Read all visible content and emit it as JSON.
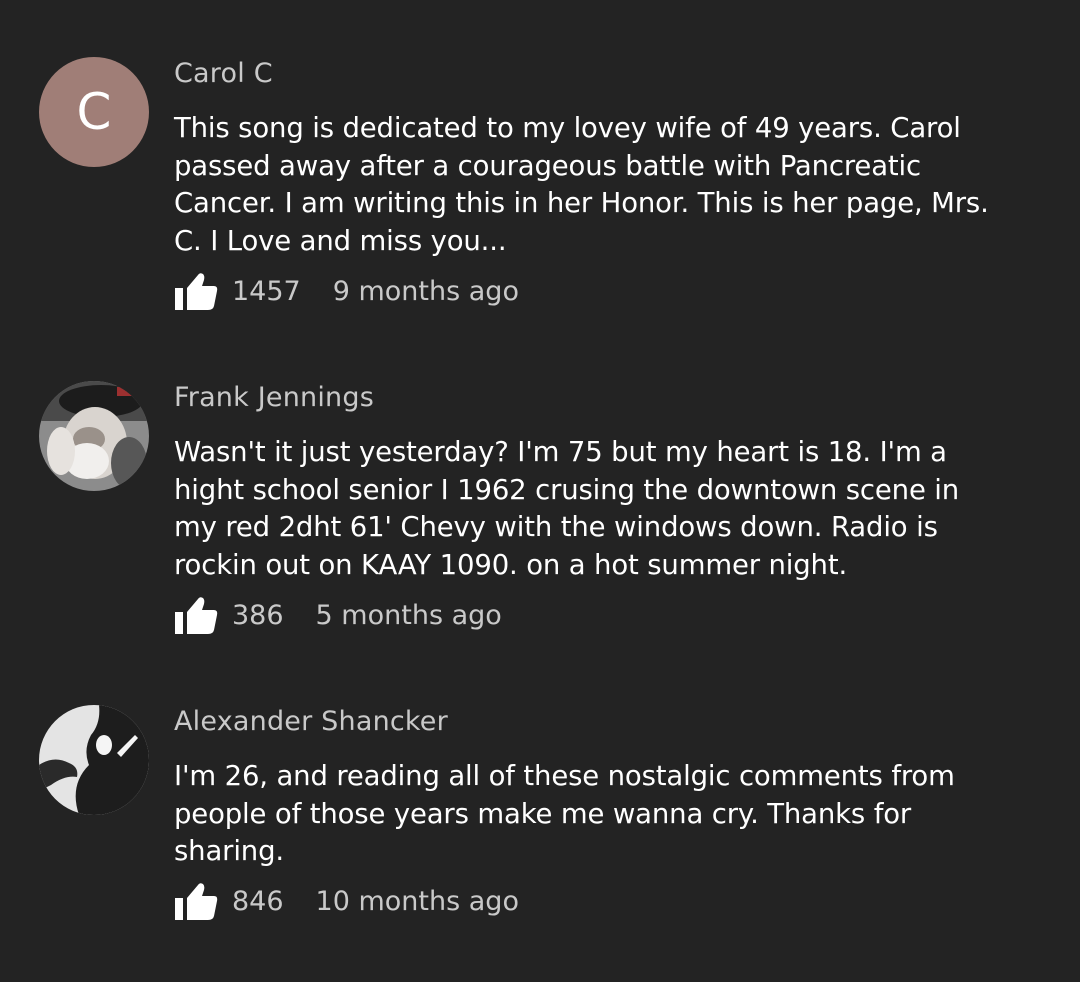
{
  "theme": {
    "background": "#232323",
    "text_primary": "#ffffff",
    "text_secondary": "#c9c9c9",
    "avatar_letter_bg": "#a07e77"
  },
  "comments": [
    {
      "author": "Carol C",
      "avatar": {
        "type": "letter",
        "letter": "C"
      },
      "lines": [
        "This song is dedicated to my lovey wife of 49 years. Carol",
        "passed away after a courageous battle with Pancreatic",
        "Cancer. I am writing this in her Honor. This is her page, Mrs.",
        "C. I Love and miss you..."
      ],
      "like_icon": "thumbs-up-icon",
      "likes": "1457",
      "time": "9 months ago"
    },
    {
      "author": "Frank Jennings",
      "avatar": {
        "type": "photo"
      },
      "lines": [
        "Wasn't it just yesterday? I'm 75 but my heart is 18. I'm a",
        "hight school senior I 1962 crusing the downtown scene in",
        "my red 2dht 61' Chevy with the windows down. Radio is",
        "rockin out on KAAY 1090. on a hot summer night."
      ],
      "like_icon": "thumbs-up-icon",
      "likes": "386",
      "time": "5 months ago"
    },
    {
      "author": "Alexander Shancker",
      "avatar": {
        "type": "photo"
      },
      "lines": [
        "I'm 26, and reading all of these nostalgic comments from",
        "people of those years make me wanna cry. Thanks for",
        "sharing."
      ],
      "like_icon": "thumbs-up-icon",
      "likes": "846",
      "time": "10 months ago"
    }
  ]
}
